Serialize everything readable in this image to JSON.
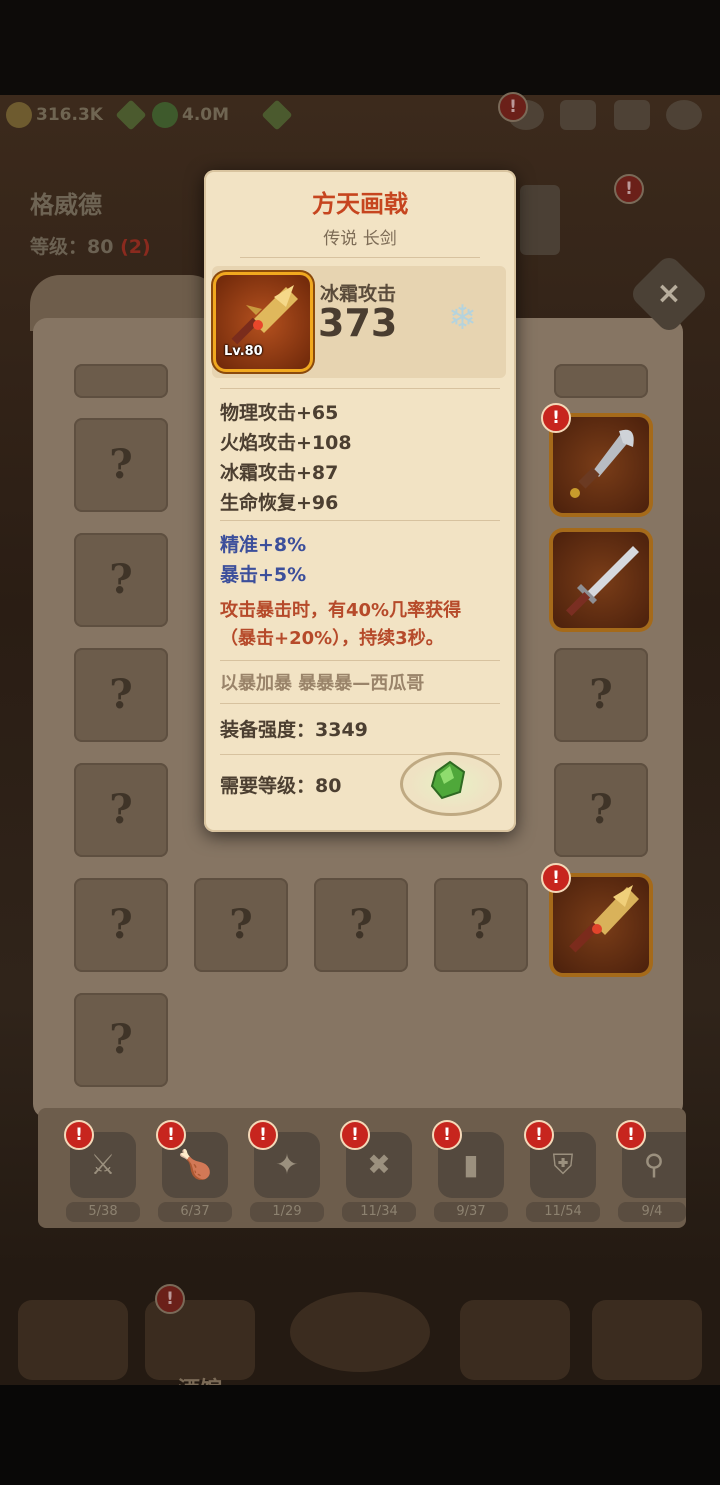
{
  "hud": {
    "gold": "316.3K",
    "gems": "4.0M"
  },
  "hero": {
    "name": "格威德",
    "level_label": "等级：80",
    "level_bonus": "(2)"
  },
  "inventory": {
    "empty_slot_mark": "?",
    "close_glyph": "×"
  },
  "tabs": [
    {
      "count": "5/38",
      "glyph": "⚔"
    },
    {
      "count": "6/37",
      "glyph": "🍗"
    },
    {
      "count": "1/29",
      "glyph": "✦"
    },
    {
      "count": "11/34",
      "glyph": "✖"
    },
    {
      "count": "9/37",
      "glyph": "▮"
    },
    {
      "count": "11/54",
      "glyph": "⛨"
    },
    {
      "count": "9/4",
      "glyph": "⚲"
    }
  ],
  "bottom_nav": {
    "tavern_label": "酒馆"
  },
  "tooltip": {
    "title": "方天画戟",
    "subtitle": "传说 长剑",
    "level_badge": "Lv.80",
    "main_stat_label": "冰霜攻击",
    "main_stat_value": "373",
    "stats": [
      "物理攻击+65",
      "火焰攻击+108",
      "冰霜攻击+87",
      "生命恢复+96"
    ],
    "bonus_stats": [
      "精准+8%",
      "暴击+5%"
    ],
    "effect_line1": "攻击暴击时，有40%几率获得",
    "effect_line2": "（暴击+20%），持续3秒。",
    "quote": "以暴加暴 暴暴暴—西瓜哥",
    "power": "装备强度：3349",
    "required_level": "需要等级：80"
  },
  "colors": {
    "title": "#c6451f",
    "bonus_blue": "#3c4f9b",
    "effect_red": "#b64a2a",
    "parchment": "#f2e3c4"
  }
}
